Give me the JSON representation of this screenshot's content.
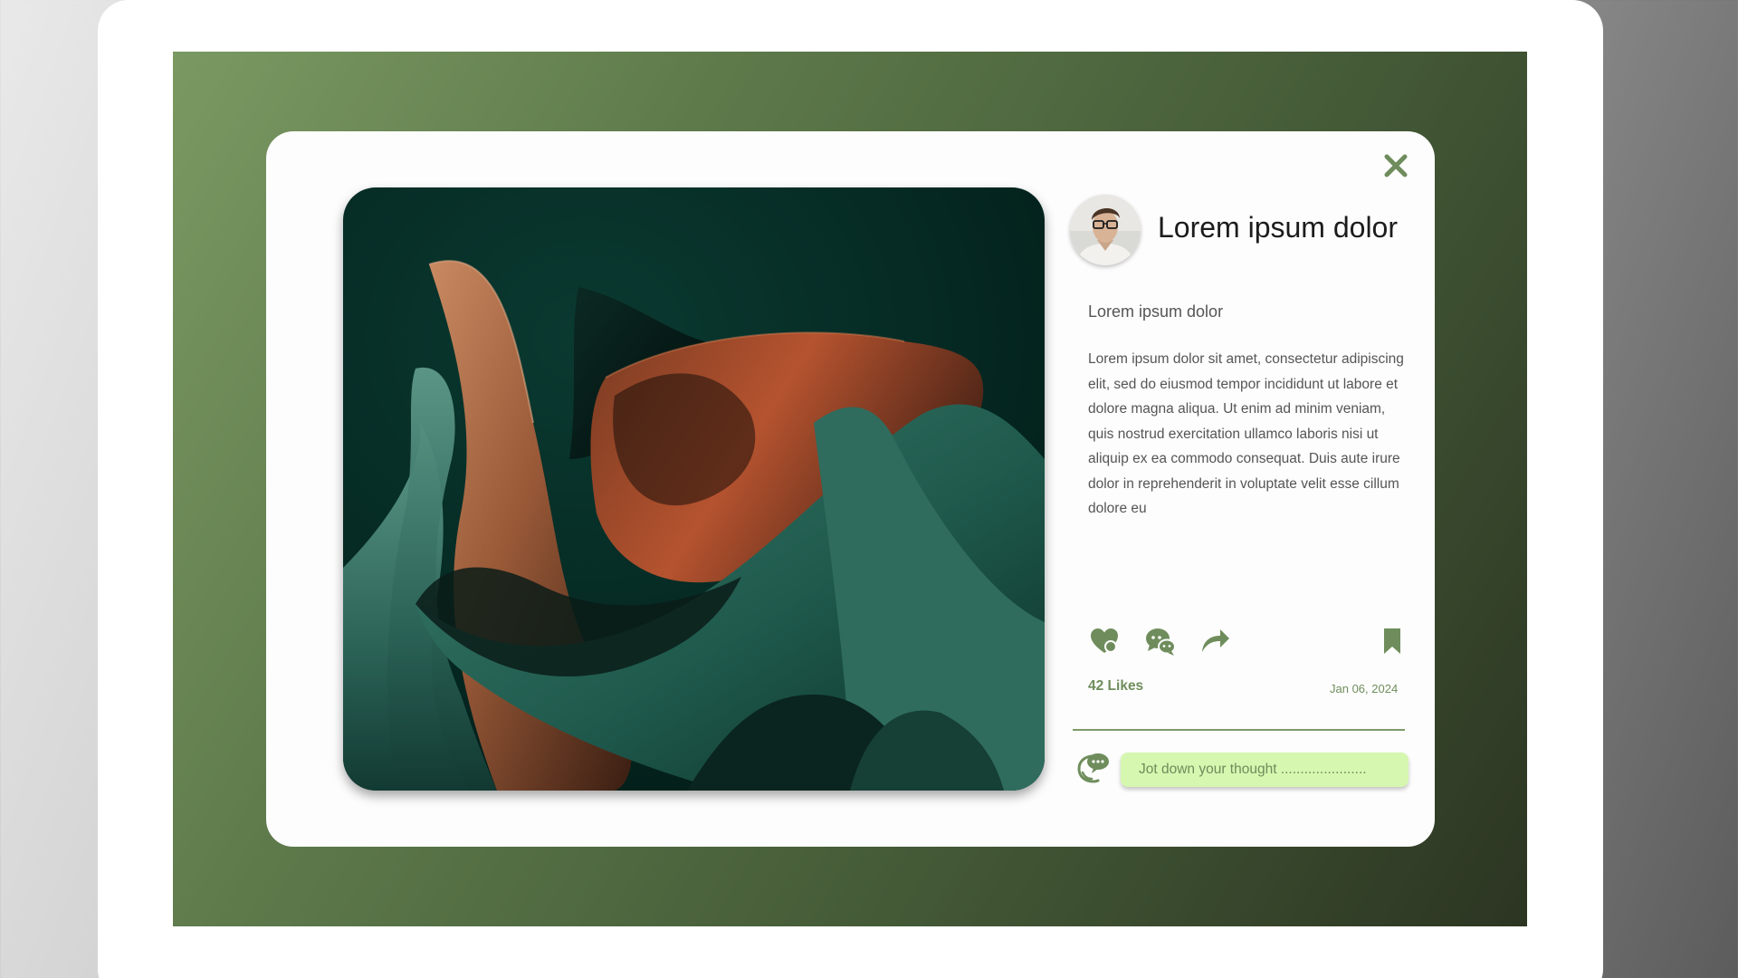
{
  "post": {
    "author_name": "Lorem ipsum dolor",
    "subtitle": "Lorem ipsum dolor",
    "body": "Lorem ipsum dolor sit amet, consectetur adipiscing elit, sed do eiusmod tempor incididunt ut labore et dolore magna aliqua. Ut enim ad minim veniam, quis nostrud exercitation ullamco laboris nisi ut aliquip ex ea commodo consequat. Duis aute irure dolor in reprehenderit in voluptate velit esse cillum dolore eu",
    "likes": "42 Likes",
    "date": "Jan 06, 2024"
  },
  "comment": {
    "placeholder": "Jot down your thought ......................"
  },
  "icons": {
    "close": "close-icon",
    "like": "heart-icon",
    "comment": "chat-icon",
    "share": "share-arrow-icon",
    "bookmark": "bookmark-icon",
    "comment_avatar": "comment-bubble-icon"
  },
  "colors": {
    "accent": "#6f8d5c",
    "input_bg": "#d6f7b0",
    "stage_start": "#7a9962",
    "stage_end": "#2c3522"
  }
}
